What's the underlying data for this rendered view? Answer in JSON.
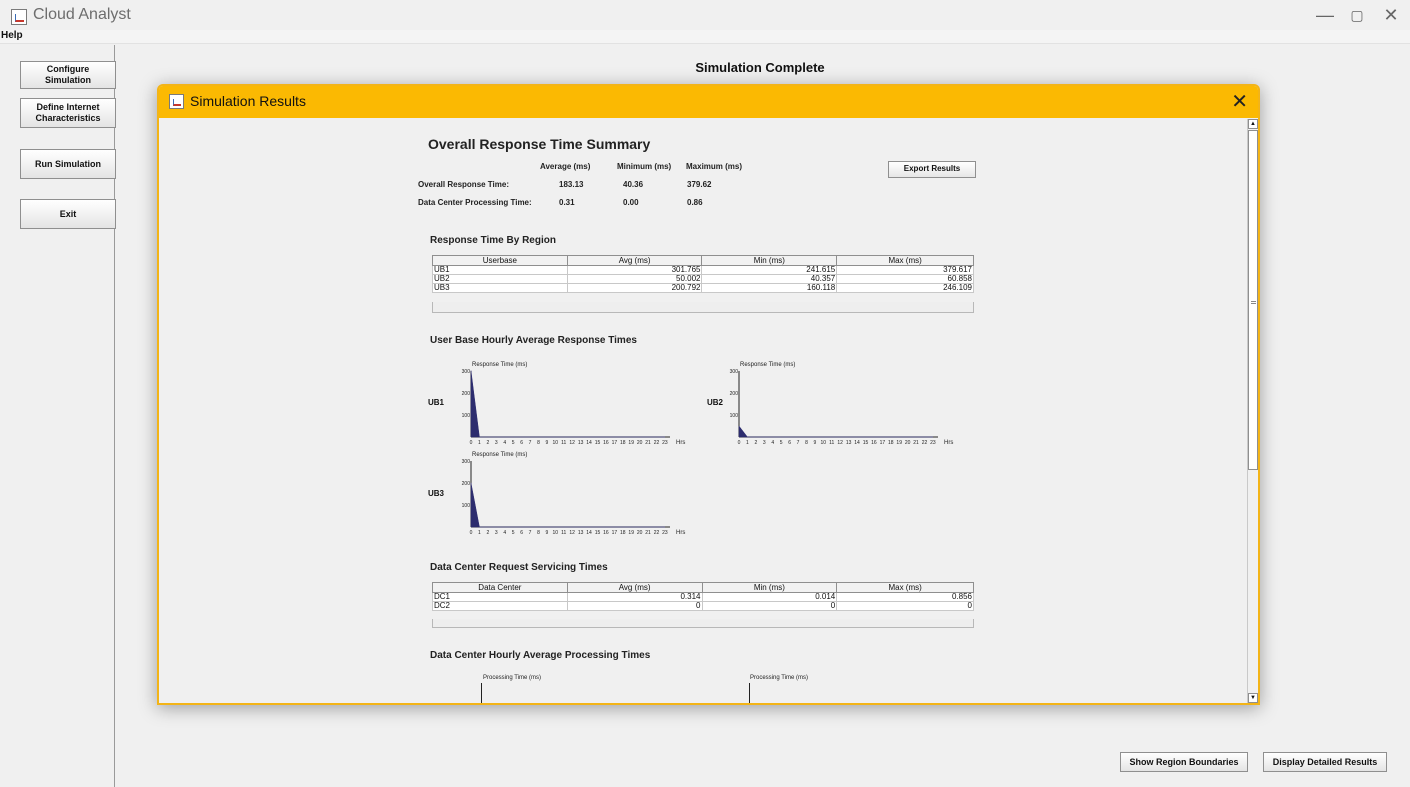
{
  "window": {
    "title": "Cloud Analyst",
    "menu": [
      "Help"
    ],
    "controls": {
      "minimize": "—",
      "restore": "▢",
      "close": "✕"
    }
  },
  "sidebar": {
    "buttons": [
      {
        "label": "Configure Simulation"
      },
      {
        "label": "Define Internet Characteristics"
      },
      {
        "label": "Run Simulation"
      },
      {
        "label": "Exit"
      }
    ]
  },
  "main": {
    "status": "Simulation Complete",
    "show_region_boundaries": "Show Region Boundaries",
    "display_detailed_results": "Display Detailed Results"
  },
  "dialog": {
    "title": "Simulation Results",
    "close": "✕",
    "summary": {
      "title": "Overall Response Time Summary",
      "headers": [
        "Average (ms)",
        "Minimum (ms)",
        "Maximum (ms)"
      ],
      "rows": [
        {
          "label": "Overall Response Time:",
          "avg": "183.13",
          "min": "40.36",
          "max": "379.62"
        },
        {
          "label": "Data Center Processing Time:",
          "avg": "0.31",
          "min": "0.00",
          "max": "0.86"
        }
      ],
      "export_button": "Export Results"
    },
    "by_region": {
      "title": "Response Time By Region",
      "columns": [
        "Userbase",
        "Avg (ms)",
        "Min (ms)",
        "Max (ms)"
      ],
      "rows": [
        [
          "UB1",
          "301.765",
          "241.615",
          "379.617"
        ],
        [
          "UB2",
          "50.002",
          "40.357",
          "60.858"
        ],
        [
          "UB3",
          "200.792",
          "160.118",
          "246.109"
        ]
      ]
    },
    "hourly": {
      "title": "User Base Hourly Average Response Times"
    },
    "dc_servicing": {
      "title": "Data Center Request Servicing Times",
      "columns": [
        "Data Center",
        "Avg (ms)",
        "Min (ms)",
        "Max (ms)"
      ],
      "rows": [
        [
          "DC1",
          "0.314",
          "0.014",
          "0.856"
        ],
        [
          "DC2",
          "0",
          "0",
          "0"
        ]
      ]
    },
    "dc_processing": {
      "title": "Data Center Hourly Average Processing Times",
      "axis_label": "Processing Time (ms)"
    }
  },
  "chart_data": [
    {
      "type": "area",
      "name": "UB1",
      "ylabel": "Response Time (ms)",
      "xlabel": "Hrs",
      "x": [
        0,
        1,
        2,
        3,
        4,
        5,
        6,
        7,
        8,
        9,
        10,
        11,
        12,
        13,
        14,
        15,
        16,
        17,
        18,
        19,
        20,
        21,
        22,
        23
      ],
      "y": [
        301.765,
        0,
        0,
        0,
        0,
        0,
        0,
        0,
        0,
        0,
        0,
        0,
        0,
        0,
        0,
        0,
        0,
        0,
        0,
        0,
        0,
        0,
        0,
        0
      ],
      "yticks": [
        100,
        200,
        300
      ],
      "ylim": [
        0,
        300
      ],
      "color": "#2d2d6e"
    },
    {
      "type": "area",
      "name": "UB2",
      "ylabel": "Response Time (ms)",
      "xlabel": "Hrs",
      "x": [
        0,
        1,
        2,
        3,
        4,
        5,
        6,
        7,
        8,
        9,
        10,
        11,
        12,
        13,
        14,
        15,
        16,
        17,
        18,
        19,
        20,
        21,
        22,
        23
      ],
      "y": [
        50.002,
        0,
        0,
        0,
        0,
        0,
        0,
        0,
        0,
        0,
        0,
        0,
        0,
        0,
        0,
        0,
        0,
        0,
        0,
        0,
        0,
        0,
        0,
        0
      ],
      "yticks": [
        100,
        200,
        300
      ],
      "ylim": [
        0,
        300
      ],
      "color": "#2d2d6e"
    },
    {
      "type": "area",
      "name": "UB3",
      "ylabel": "Response Time (ms)",
      "xlabel": "Hrs",
      "x": [
        0,
        1,
        2,
        3,
        4,
        5,
        6,
        7,
        8,
        9,
        10,
        11,
        12,
        13,
        14,
        15,
        16,
        17,
        18,
        19,
        20,
        21,
        22,
        23
      ],
      "y": [
        200.792,
        0,
        0,
        0,
        0,
        0,
        0,
        0,
        0,
        0,
        0,
        0,
        0,
        0,
        0,
        0,
        0,
        0,
        0,
        0,
        0,
        0,
        0,
        0
      ],
      "yticks": [
        100,
        200,
        300
      ],
      "ylim": [
        0,
        300
      ],
      "color": "#2d2d6e"
    }
  ]
}
